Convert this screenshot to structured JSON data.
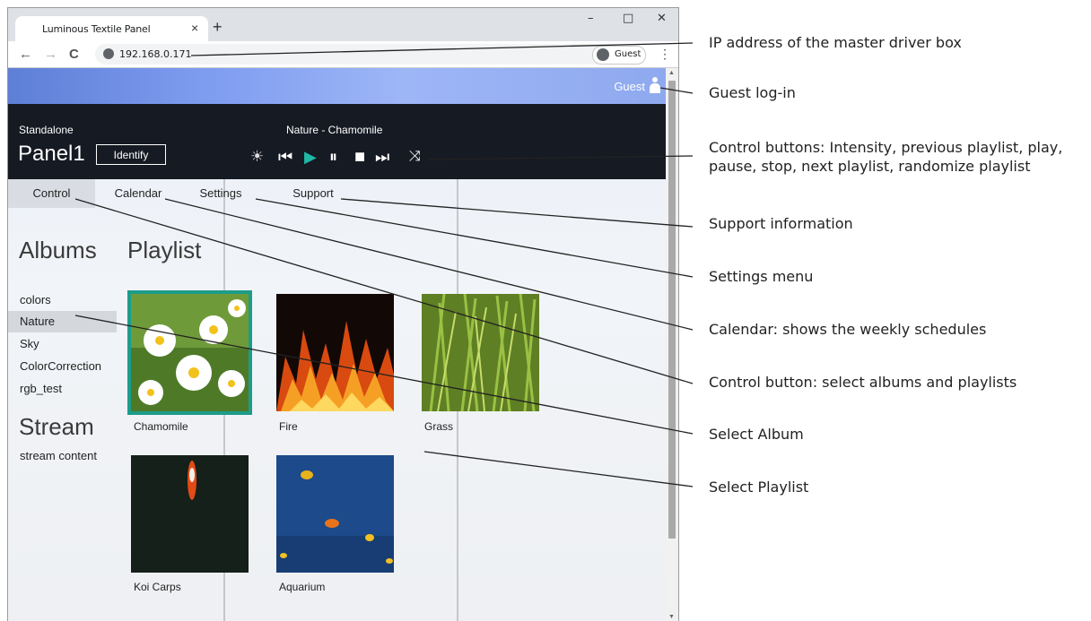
{
  "browser": {
    "tab_title": "Luminous Textile Panel",
    "tab_close": "×",
    "new_tab": "+",
    "window_controls": {
      "minimize": "–",
      "maximize": "□",
      "close": "✕"
    },
    "nav": {
      "back": "←",
      "forward": "→",
      "reload": "C"
    },
    "url": "192.168.0.171",
    "profile_label": "Guest",
    "menu": "⋮"
  },
  "app": {
    "user_label": "Guest",
    "mode": "Standalone",
    "panel_name": "Panel1",
    "identify_label": "Identify",
    "now_playing": "Nature - Chamomile",
    "controls": {
      "intensity": "☀",
      "previous": "⏮",
      "play": "▶",
      "pause": "⏸",
      "stop": "■",
      "next": "⏭",
      "shuffle": "⤨"
    },
    "nav_tabs": [
      "Control",
      "Calendar",
      "Settings",
      "Support"
    ],
    "active_tab": "Control",
    "albums_heading": "Albums",
    "albums": [
      "colors",
      "Nature",
      "Sky",
      "ColorCorrection",
      "rgb_test"
    ],
    "selected_album": "Nature",
    "stream_heading": "Stream",
    "stream_item": "stream content",
    "playlist_heading": "Playlist",
    "playlists": [
      "Chamomile",
      "Fire",
      "Grass",
      "Koi Carps",
      "Aquarium"
    ],
    "selected_playlist": "Chamomile",
    "accent_color": "#1e9c8a",
    "play_color": "#1fb8a4"
  },
  "annotations": [
    "IP address of the master driver box",
    "Guest log-in",
    "Control buttons: Intensity, previous playlist, play,",
    "pause, stop, next playlist, randomize playlist",
    "Support information",
    "Settings menu",
    "Calendar: shows the weekly schedules",
    "Control button: select albums and playlists",
    "Select Album",
    "Select Playlist"
  ]
}
